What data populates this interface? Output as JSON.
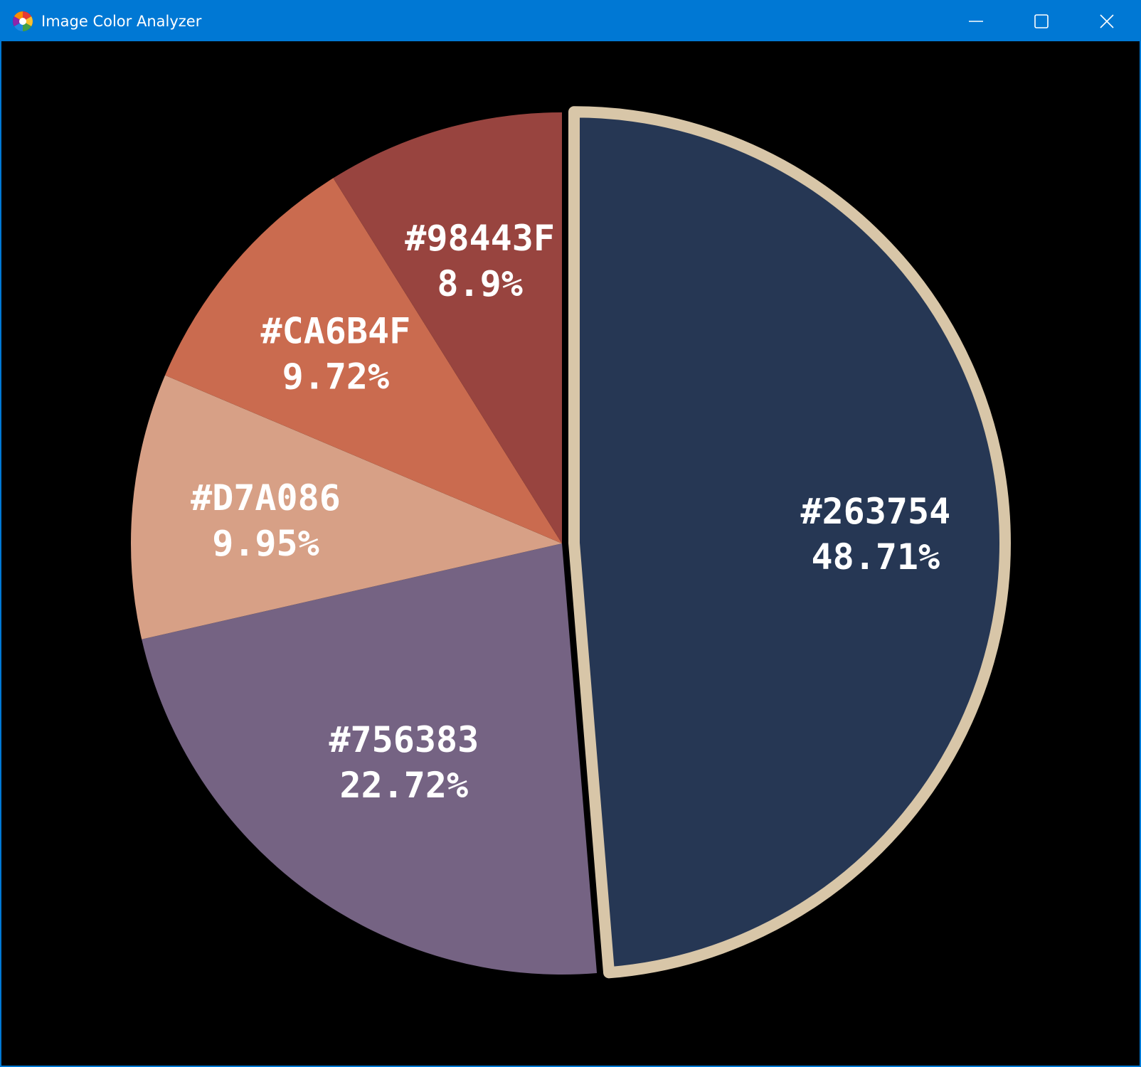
{
  "window": {
    "title": "Image Color Analyzer",
    "controls": [
      {
        "name": "minimize-icon"
      },
      {
        "name": "maximize-icon"
      },
      {
        "name": "close-icon"
      }
    ],
    "titlebar_color": "#0078d4",
    "background_color": "#000000",
    "highlight_color": "#D8C6A8"
  },
  "chart_data": {
    "type": "pie",
    "title": "",
    "start": "top",
    "direction": "clockwise",
    "highlighted_slice": "#263754",
    "slices": [
      {
        "color": "#263754",
        "label": "#263754",
        "value": 48.71,
        "value_label": "48.71%"
      },
      {
        "color": "#756383",
        "label": "#756383",
        "value": 22.72,
        "value_label": "22.72%"
      },
      {
        "color": "#D7A086",
        "label": "#D7A086",
        "value": 9.95,
        "value_label": "9.95%"
      },
      {
        "color": "#CA6B4F",
        "label": "#CA6B4F",
        "value": 9.72,
        "value_label": "9.72%"
      },
      {
        "color": "#98443F",
        "label": "#98443F",
        "value": 8.9,
        "value_label": "8.9%"
      }
    ]
  }
}
